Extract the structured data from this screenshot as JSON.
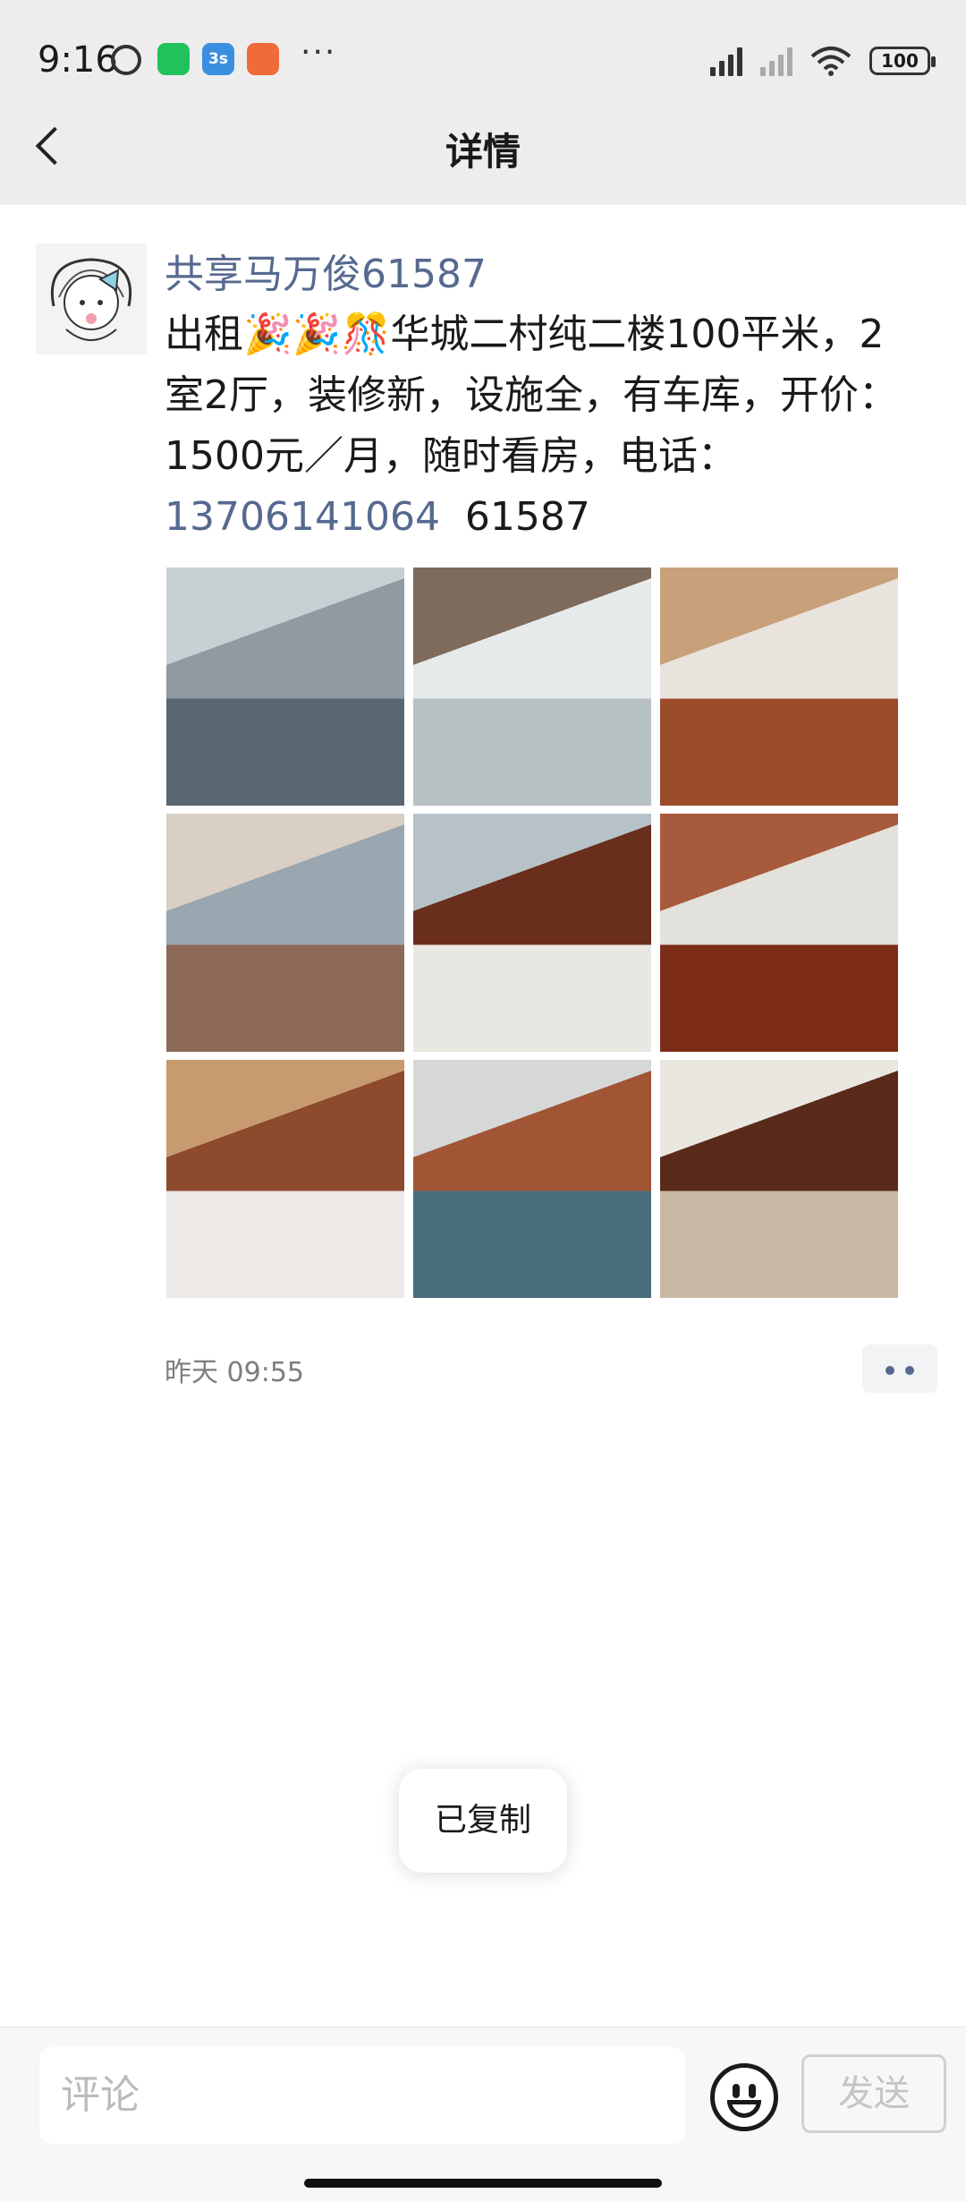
{
  "status_bar": {
    "time": "9:16",
    "battery": "100",
    "more": "···",
    "app3s": "3s"
  },
  "header": {
    "title": "详情"
  },
  "post": {
    "author": "共享马万俊61587",
    "text_prefix": "出租🎉🎉🎊华城二村纯二楼100平米，2室2厅，装修新，设施全，有车库，开价：1500元／月，随时看房，电话：",
    "phone": "13706141064",
    "text_suffix": "61587",
    "photos": [
      {
        "name": "kitchen",
        "colors": [
          "#5a6670",
          "#8f9aa3",
          "#c9d0d4"
        ]
      },
      {
        "name": "bathroom",
        "colors": [
          "#b7c1c4",
          "#e7eaeb",
          "#7e6b5c"
        ]
      },
      {
        "name": "bedroom-1",
        "colors": [
          "#9a4b2a",
          "#e9e3de",
          "#c8a07a"
        ]
      },
      {
        "name": "bedroom-2",
        "colors": [
          "#8c6a57",
          "#9aa7b1",
          "#d9cfc4"
        ]
      },
      {
        "name": "dining-room",
        "colors": [
          "#e9e7e2",
          "#6a2e1c",
          "#b6c2c7"
        ]
      },
      {
        "name": "living-sofa",
        "colors": [
          "#7d2c18",
          "#e3e1dc",
          "#a85a3c"
        ]
      },
      {
        "name": "living-tv",
        "colors": [
          "#ece9e6",
          "#8e4a2c",
          "#c79b6f"
        ]
      },
      {
        "name": "dining-window",
        "colors": [
          "#4a6d7c",
          "#a25535",
          "#d5d8d6"
        ]
      },
      {
        "name": "dining-table",
        "colors": [
          "#c8b8a4",
          "#5a2a1a",
          "#eae6e0"
        ]
      }
    ],
    "timestamp": "昨天 09:55"
  },
  "toast": {
    "text": "已复制"
  },
  "comment_bar": {
    "placeholder": "评论",
    "send_label": "发送"
  }
}
